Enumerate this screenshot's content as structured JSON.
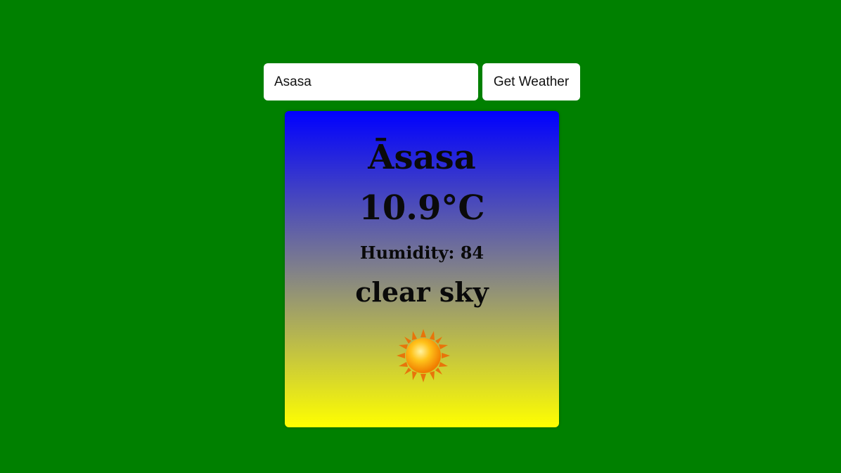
{
  "search": {
    "value": "Asasa"
  },
  "toolbar": {
    "button_label": "Get Weather"
  },
  "weather": {
    "city": "Āsasa",
    "temperature": "10.9°C",
    "humidity": "Humidity: 84",
    "description": "clear sky",
    "icon": "sun-icon"
  },
  "colors": {
    "page_background": "#008000",
    "card_gradient_top": "#0000ff",
    "card_gradient_bottom": "#ffff00",
    "sun": "#ffb300"
  }
}
